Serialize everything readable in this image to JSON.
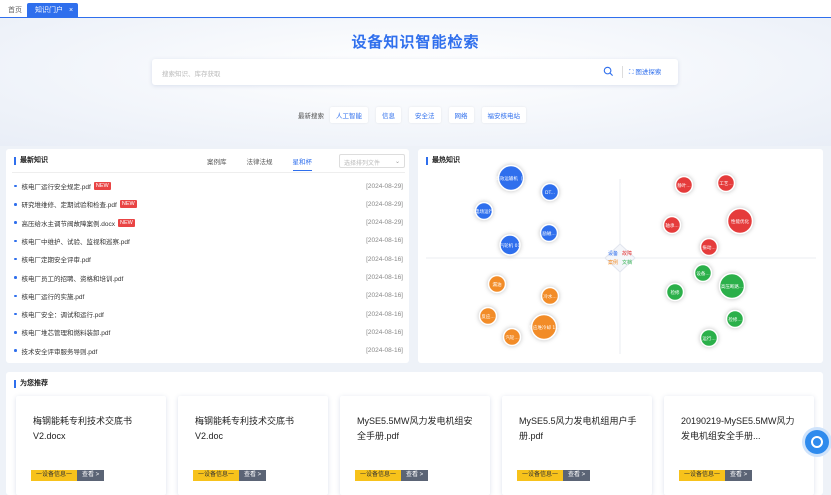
{
  "tabs": {
    "home": "首页",
    "active": "知识门户",
    "close": "×"
  },
  "hero": {
    "title": "设备知识智能检索",
    "search_placeholder": "搜索知识、库存获取",
    "image_search": "图进探索",
    "hot_label": "最新搜索",
    "hot_chips": [
      "人工智能",
      "信息",
      "安全法",
      "网络",
      "福安核电站"
    ]
  },
  "latest": {
    "title": "最新知识",
    "tabs": [
      "案例库",
      "法律法规",
      "星和杯"
    ],
    "active_tab": 2,
    "select_placeholder": "选择排列文件",
    "rows": [
      {
        "name": "核电厂运行安全规定.pdf",
        "new": true,
        "date": "[2024-08-29]"
      },
      {
        "name": "研究堆维修、定期试验和检查.pdf",
        "new": true,
        "date": "[2024-08-29]"
      },
      {
        "name": "高压给水主调节阀故障案例.docx",
        "new": true,
        "date": "[2024-08-29]"
      },
      {
        "name": "核电厂中维护、试验、监视和巡察.pdf",
        "new": false,
        "date": "[2024-08-16]"
      },
      {
        "name": "核电厂定期安全评审.pdf",
        "new": false,
        "date": "[2024-08-16]"
      },
      {
        "name": "核电厂员工的招聘、资格和培训.pdf",
        "new": false,
        "date": "[2024-08-16]"
      },
      {
        "name": "核电厂运行的实施.pdf",
        "new": false,
        "date": "[2024-08-16]"
      },
      {
        "name": "核电厂安全：调试和运行.pdf",
        "new": false,
        "date": "[2024-08-16]"
      },
      {
        "name": "核电厂堆芯管理和燃料装卸.pdf",
        "new": false,
        "date": "[2024-08-16]"
      },
      {
        "name": "技术安全评审服务导则.pdf",
        "new": false,
        "date": "[2024-08-16]"
      }
    ],
    "new_label": "NEW"
  },
  "hotpanel": {
    "title": "最热知识",
    "center_labels": [
      "设备",
      "故障",
      "案例",
      "文档"
    ],
    "colors": {
      "blue": "#2f6fed",
      "red": "#e53b3b",
      "green": "#2bb04a",
      "orange": "#f28c28"
    },
    "bubbles": [
      {
        "label": "高效运输机（...",
        "color": "blue",
        "size": "l"
      },
      {
        "label": "DT...",
        "color": "blue",
        "size": "s"
      },
      {
        "label": "风电场运行...",
        "color": "blue",
        "size": "s"
      },
      {
        "label": "励磁...",
        "color": "blue",
        "size": "s"
      },
      {
        "label": "汽轮机 01",
        "color": "blue",
        "size": "m"
      },
      {
        "label": "静叶...",
        "color": "red",
        "size": "s"
      },
      {
        "label": "工艺...",
        "color": "red",
        "size": "s"
      },
      {
        "label": "性能优化",
        "color": "red",
        "size": "l"
      },
      {
        "label": "轴承...",
        "color": "red",
        "size": "s"
      },
      {
        "label": "振动...",
        "color": "red",
        "size": "s"
      },
      {
        "label": "漏油",
        "color": "orange",
        "size": "s"
      },
      {
        "label": "冷水...",
        "color": "orange",
        "size": "s"
      },
      {
        "label": "反应...",
        "color": "orange",
        "size": "s"
      },
      {
        "label": "反应堆冷却 1...",
        "color": "orange",
        "size": "l"
      },
      {
        "label": "汽轮...",
        "color": "orange",
        "size": "s"
      },
      {
        "label": "设备...",
        "color": "green",
        "size": "s"
      },
      {
        "label": "高压断路...",
        "color": "green",
        "size": "l"
      },
      {
        "label": "检修",
        "color": "green",
        "size": "s"
      },
      {
        "label": "检修...",
        "color": "green",
        "size": "s"
      },
      {
        "label": "运行...",
        "color": "green",
        "size": "s"
      }
    ]
  },
  "rec": {
    "title": "为您推荐",
    "cards": [
      {
        "title": "梅钢能耗专利技术交底书V2.docx",
        "tag": "一设备信息一",
        "view": "查看 >"
      },
      {
        "title": "梅钢能耗专利技术交底书V2.doc",
        "tag": "一设备信息一",
        "view": "查看 >"
      },
      {
        "title": "MySE5.5MW风力发电机组安全手册.pdf",
        "tag": "一设备信息一",
        "view": "查看 >"
      },
      {
        "title": "MySE5.5风力发电机组用户手册.pdf",
        "tag": "一设备信息一",
        "view": "查看 >"
      },
      {
        "title": "20190219-MySE5.5MW风力发电机组安全手册...",
        "tag": "一设备信息一",
        "view": "查看 >"
      }
    ]
  }
}
